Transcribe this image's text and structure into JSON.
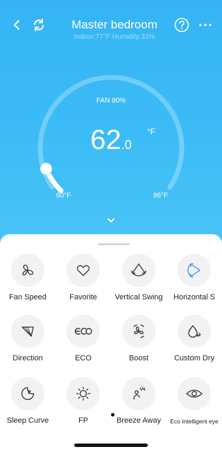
{
  "header": {
    "title": "Master bedroom",
    "subtitle": "Indoor:77°F Humidity:33%"
  },
  "dial": {
    "fan_text": "FAN 80%",
    "temp_int": "62",
    "temp_dec": ".0",
    "unit": "°F",
    "min_label": "60°F",
    "max_label": "86°F",
    "setpoint_fraction": 0.08
  },
  "functions": [
    {
      "label": "Fan Speed",
      "icon": "fan-speed-icon"
    },
    {
      "label": "Favorite",
      "icon": "heart-icon"
    },
    {
      "label": "Vertical Swing",
      "icon": "vertical-swing-icon"
    },
    {
      "label": "Horizontal S",
      "icon": "horizontal-swing-icon"
    },
    {
      "label": "Direction",
      "icon": "direction-icon"
    },
    {
      "label": "ECO",
      "icon": "eco-icon"
    },
    {
      "label": "Boost",
      "icon": "boost-icon"
    },
    {
      "label": "Custom Dry",
      "icon": "custom-dry-icon"
    },
    {
      "label": "Sleep Curve",
      "icon": "sleep-curve-icon"
    },
    {
      "label": "FP",
      "icon": "sun-icon"
    },
    {
      "label": "Breeze Away",
      "icon": "breeze-away-icon"
    },
    {
      "label": "Eco Intelligent eye",
      "icon": "eye-icon"
    }
  ],
  "colors": {
    "hero": "#3cbcf6",
    "active_icon": "#3a8df3"
  }
}
